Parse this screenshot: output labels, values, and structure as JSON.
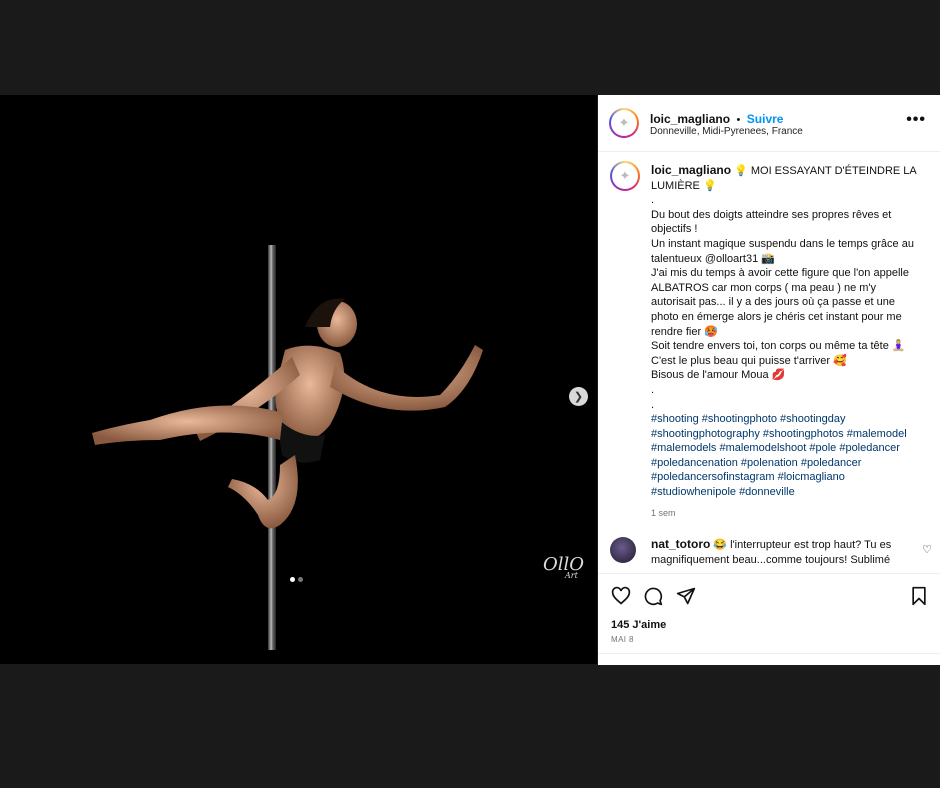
{
  "post": {
    "username": "loic_magliano",
    "separator": "•",
    "follow_label": "Suivre",
    "location": "Donneville, Midi-Pyrenees, France",
    "more_label": "•••"
  },
  "caption": {
    "username": "loic_magliano",
    "lines": [
      "💡 MOI ESSAYANT D'ÉTEINDRE LA LUMIÈRE 💡",
      ".",
      "Du bout des doigts atteindre ses propres rêves et objectifs !",
      "Un instant magique suspendu dans le temps grâce au talentueux @olloart31 📸",
      "J'ai mis du temps à avoir cette figure que l'on appelle ALBATROS car mon corps ( ma peau ) ne m'y autorisait pas... il y a des jours où ça passe et une photo en émerge alors je chéris cet instant pour me rendre fier 🥵",
      "Soit tendre envers toi, ton corps ou même ta tête 🧘🏼‍♀️",
      "C'est le plus beau qui puisse t'arriver 🥰",
      "Bisous de l'amour Moua 💋",
      ".",
      "."
    ],
    "hashtags": "#shooting #shootingphoto #shootingday #shootingphotography #shootingphotos #malemodel #malemodels #malemodelshoot #pole #poledancer #poledancenation #polenation #poledancer #poledancersofinstagram #loicmagliano #studiowhenipole #donneville",
    "time": "1 sem"
  },
  "comment": {
    "username": "nat_totoro",
    "text": "😂 l'interrupteur est trop haut? Tu es magnifiquement beau...comme toujours! Sublimé"
  },
  "stats": {
    "likes": "145 J'aime",
    "date": "MAI 8"
  },
  "photo": {
    "watermark": "OllO",
    "watermark_sub": "Art"
  }
}
